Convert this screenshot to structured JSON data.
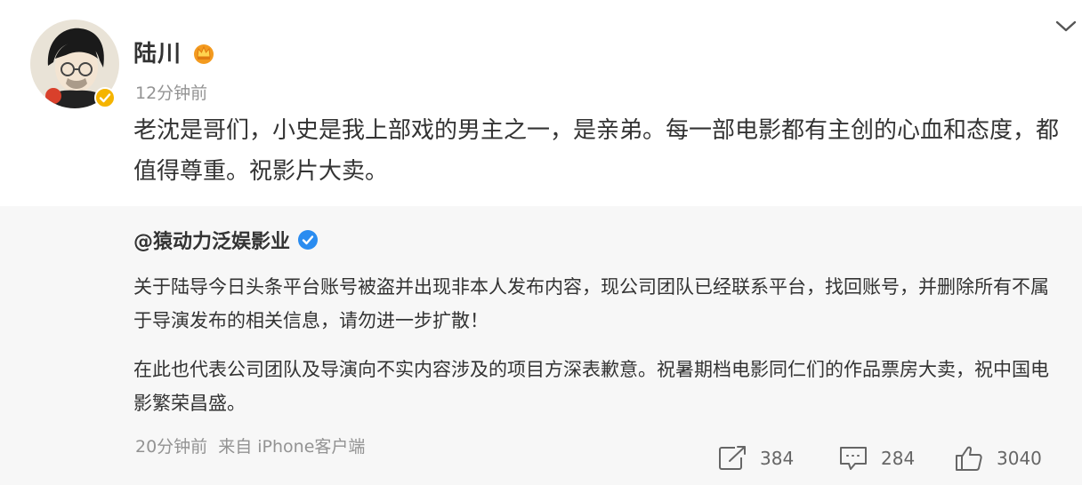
{
  "post": {
    "author": "陆川",
    "time": "12分钟前",
    "text": "老沈是哥们，小史是我上部戏的男主之一，是亲弟。每一部电影都有主创的心血和态度，都值得尊重。祝影片大卖。",
    "icons": {
      "avatar": "avatar",
      "crown": "crown-icon",
      "verified": "verified-yellow-icon",
      "menu": "chevron-down-icon"
    }
  },
  "repost": {
    "author": "@猿动力泛娱影业",
    "paragraphs": [
      "关于陆导今日头条平台账号被盗并出现非本人发布内容，现公司团队已经联系平台，找回账号，并删除所有不属于导演发布的相关信息，请勿进一步扩散！",
      "在此也代表公司团队及导演向不实内容涉及的项目方深表歉意。祝暑期档电影同仁们的作品票房大卖，祝中国电影繁荣昌盛。"
    ],
    "time": "20分钟前",
    "source": "来自 iPhone客户端",
    "verified_icon": "verified-blue-icon"
  },
  "actions": {
    "reposts": "384",
    "comments": "284",
    "likes": "3040"
  },
  "colors": {
    "text": "#333333",
    "muted": "#939393",
    "card_bg": "#f7f7f7",
    "weibo_blue": "#2a8cf0",
    "verified_gold": "#f5b400"
  }
}
